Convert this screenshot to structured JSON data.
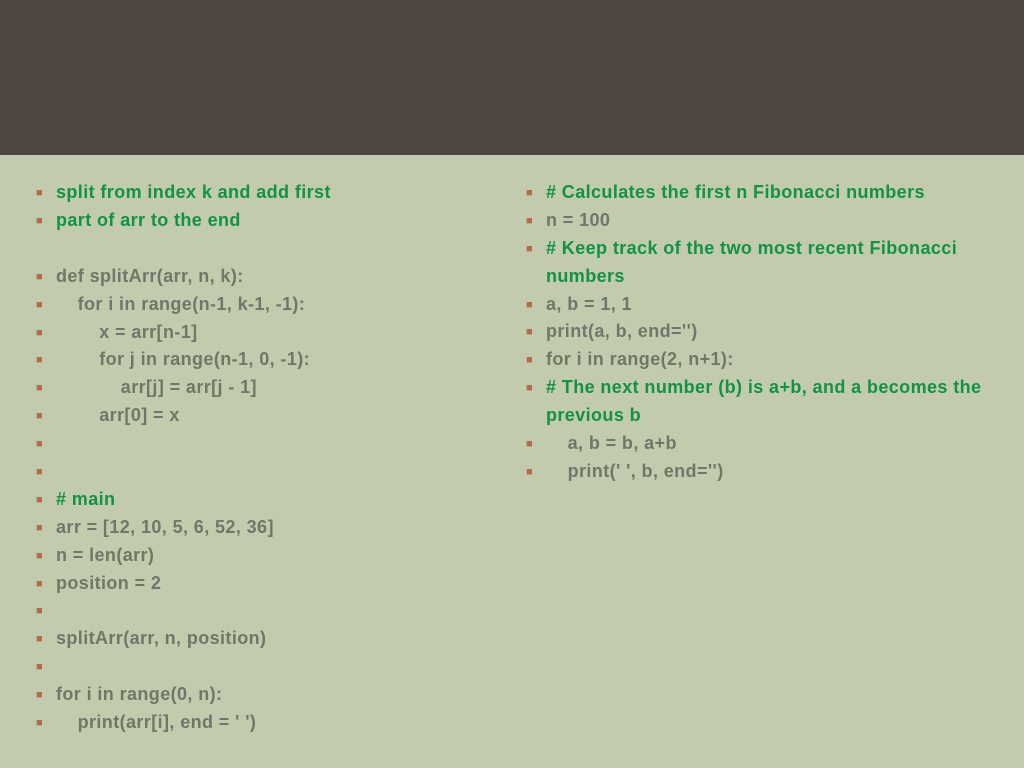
{
  "left": [
    {
      "text": "split from index k and add first",
      "cls": ""
    },
    {
      "text": "part of arr to the end",
      "cls": ""
    },
    {
      "text": "",
      "cls": "",
      "blank": true
    },
    {
      "text": "def splitArr(arr, n, k):",
      "cls": "gray"
    },
    {
      "text": "    for i in range(n-1, k-1, -1):",
      "cls": "gray"
    },
    {
      "text": "        x = arr[n-1]",
      "cls": "gray"
    },
    {
      "text": "        for j in range(n-1, 0, -1):",
      "cls": "gray"
    },
    {
      "text": "            arr[j] = arr[j - 1]",
      "cls": "gray"
    },
    {
      "text": "        arr[0] = x",
      "cls": "gray"
    },
    {
      "text": "",
      "cls": "gray"
    },
    {
      "text": "",
      "cls": "gray"
    },
    {
      "text": "# main",
      "cls": ""
    },
    {
      "text": "arr = [12, 10, 5, 6, 52, 36]",
      "cls": "gray"
    },
    {
      "text": "n = len(arr)",
      "cls": "gray"
    },
    {
      "text": "position = 2",
      "cls": "gray"
    },
    {
      "text": "",
      "cls": "gray"
    },
    {
      "text": "splitArr(arr, n, position)",
      "cls": "gray"
    },
    {
      "text": "",
      "cls": "gray"
    },
    {
      "text": "for i in range(0, n):",
      "cls": "gray"
    },
    {
      "text": "    print(arr[i], end = ' ')",
      "cls": "gray"
    }
  ],
  "right": [
    {
      "text": "# Calculates the first n Fibonacci numbers",
      "cls": "wrap"
    },
    {
      "text": "n = 100",
      "cls": "gray"
    },
    {
      "text": "# Keep track of the two most recent Fibonacci numbers",
      "cls": "wrap"
    },
    {
      "text": "a, b = 1, 1",
      "cls": "gray"
    },
    {
      "text": "print(a, b, end='')",
      "cls": "gray"
    },
    {
      "text": "for i in range(2, n+1):",
      "cls": "gray"
    },
    {
      "text": "    # The next number (b) is a+b, and a becomes the previous b",
      "cls": "wrap"
    },
    {
      "text": "    a, b = b, a+b",
      "cls": "gray"
    },
    {
      "text": "    print(' ', b, end='')",
      "cls": "gray"
    }
  ]
}
